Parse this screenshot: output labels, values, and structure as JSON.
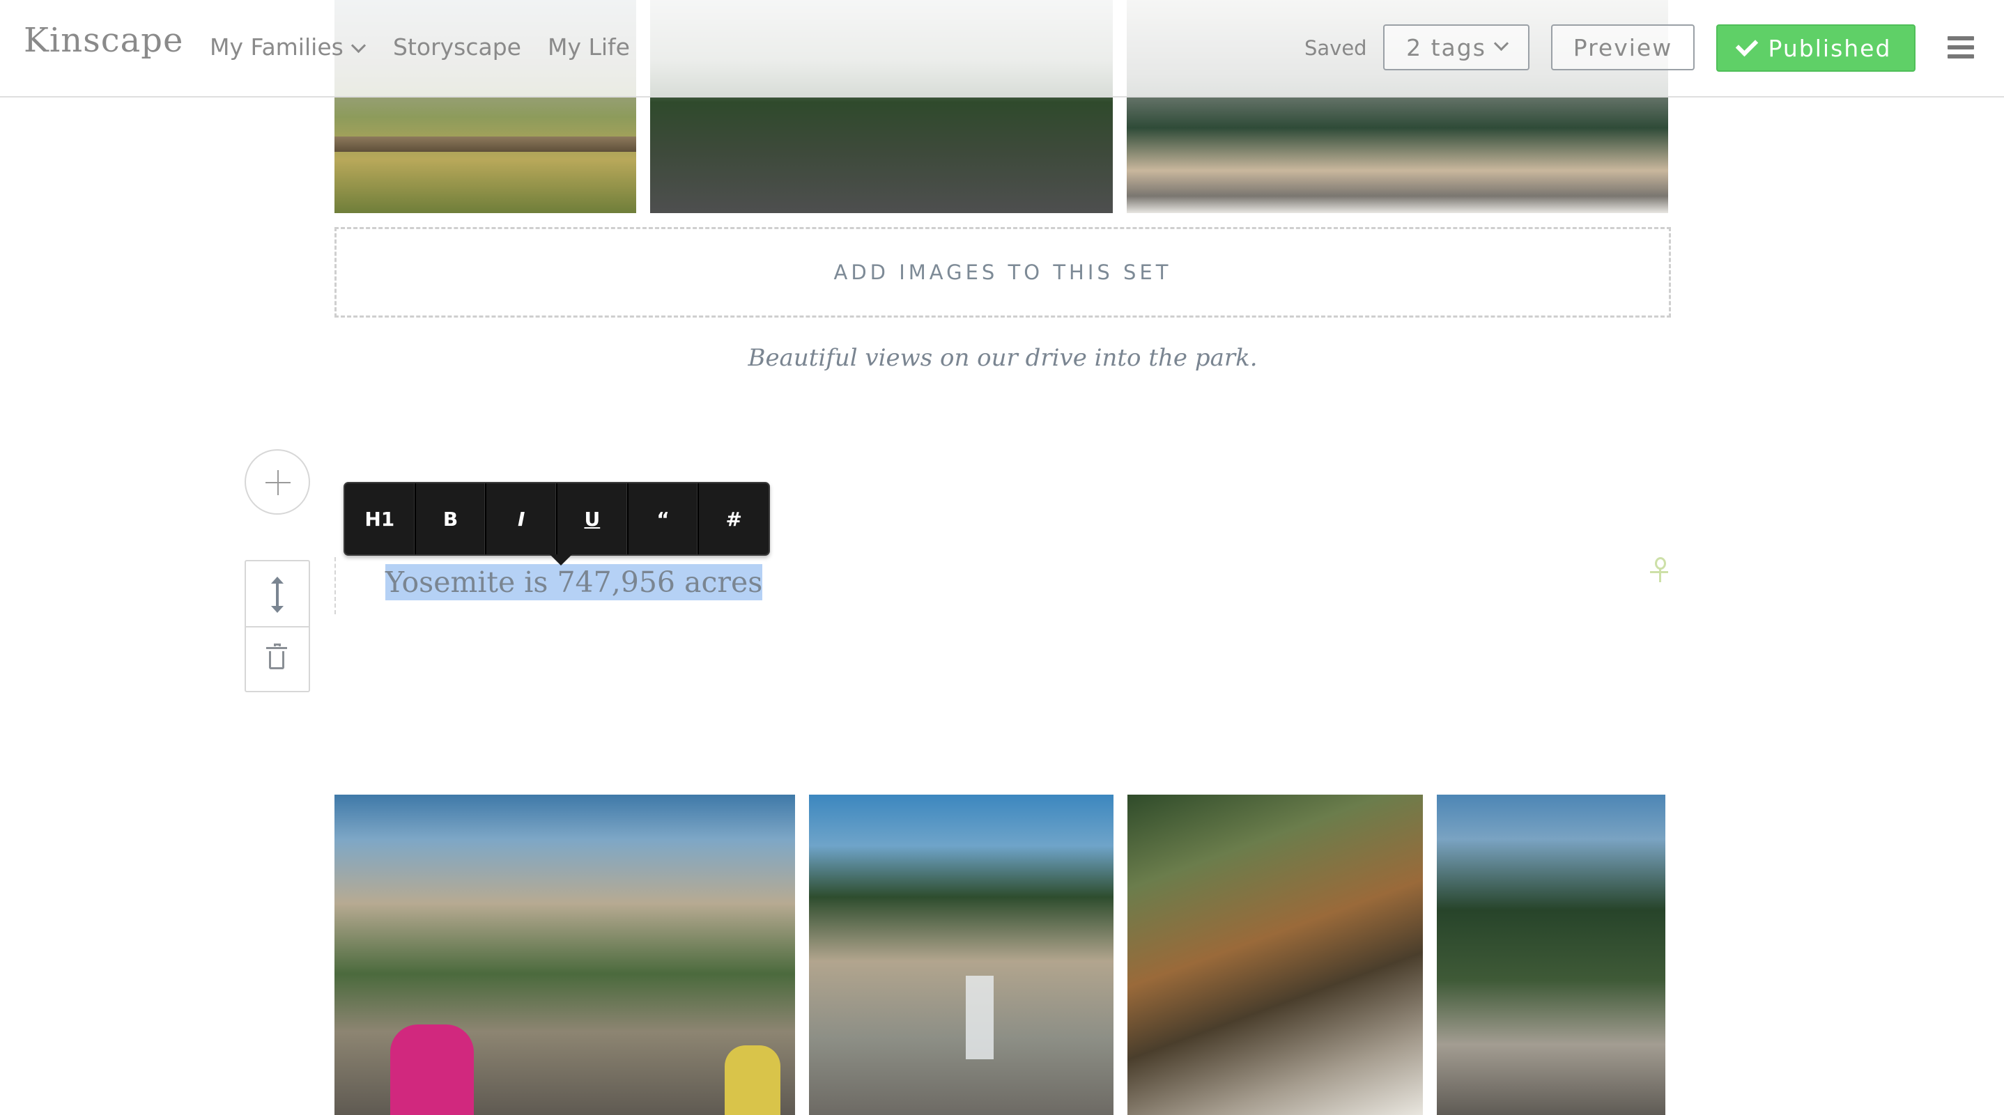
{
  "header": {
    "logo": "Kinscape",
    "nav": {
      "my_families": "My Families",
      "storyscape": "Storyscape",
      "my_life": "My Life"
    },
    "status": "Saved",
    "tags_label": "2 tags",
    "preview_label": "Preview",
    "published_label": "Published"
  },
  "editor": {
    "add_images_label": "ADD IMAGES TO THIS SET",
    "caption": "Beautiful views on our drive into the park.",
    "toolbar": {
      "h1": "H1",
      "bold": "B",
      "italic": "I",
      "underline": "U",
      "quote": "“",
      "hash": "#"
    },
    "selected_text": "Yosemite is 747,956 acres"
  },
  "icons": {
    "add_block": "plus-icon",
    "move": "move-vertical-icon",
    "delete": "trash-icon",
    "menu": "hamburger-icon",
    "dropdown": "chevron-down-icon",
    "check": "check-icon",
    "marker": "ankh-icon"
  },
  "colors": {
    "published_green": "#5fd067",
    "selection_blue": "#b5d1f5",
    "toolbar_dark": "#1b1b1b"
  }
}
